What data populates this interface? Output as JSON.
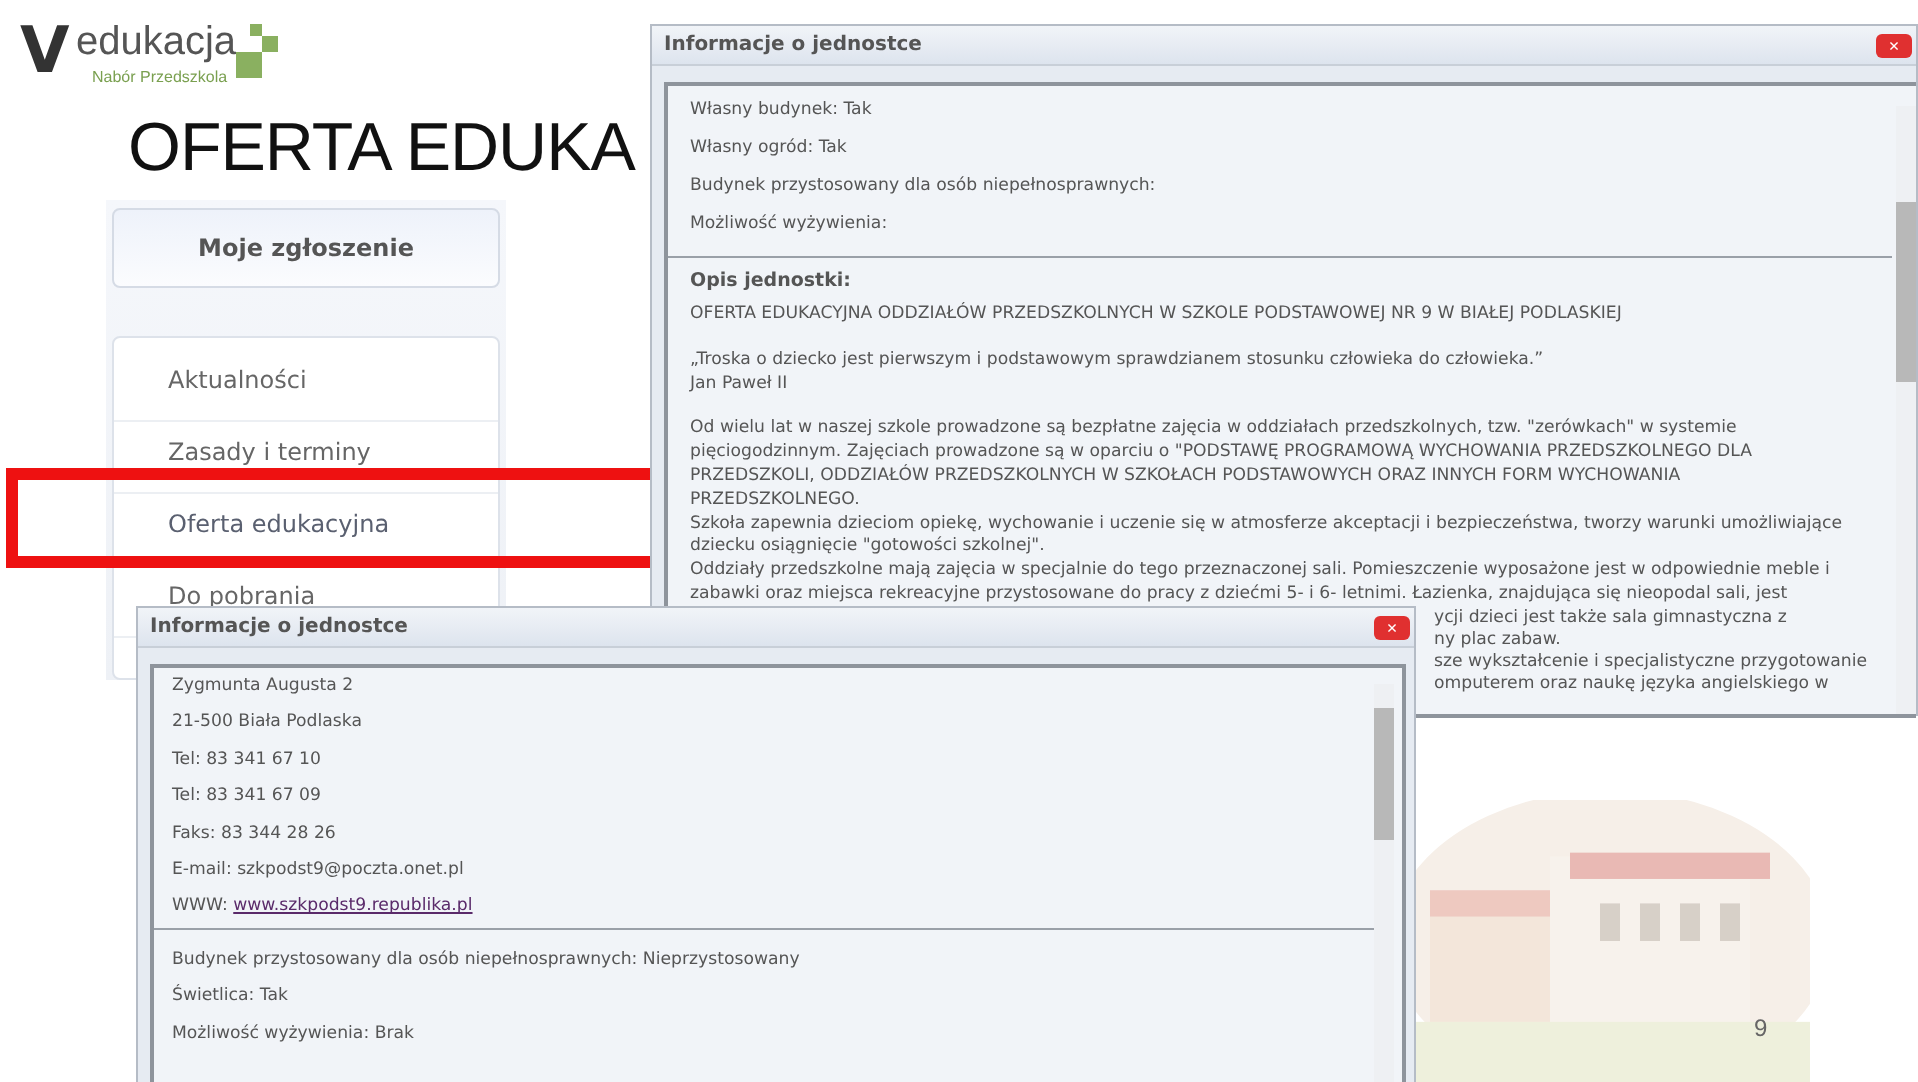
{
  "logo": {
    "mark": "V",
    "name": "edukacja",
    "tagline": "Nabór Przedszkola"
  },
  "slide_title": "OFERTA EDUKA",
  "sidebar": {
    "top_button": "Moje zgłoszenie",
    "items": [
      {
        "label": "Aktualności",
        "selected": false
      },
      {
        "label": "Zasady i terminy",
        "selected": false
      },
      {
        "label": "Oferta edukacyjna",
        "selected": true
      },
      {
        "label": "Do pobrania",
        "selected": false
      }
    ]
  },
  "back_window": {
    "title": "Informacje o jednostce",
    "close": "×",
    "facts": [
      "Własny budynek: Tak",
      "Własny ogród: Tak",
      "Budynek przystosowany dla osób niepełnosprawnych:",
      "Możliwość wyżywienia:"
    ],
    "description_heading": "Opis jednostki:",
    "paragraphs": [
      [
        "OFERTA EDUKACYJNA ODDZIAŁÓW PRZEDSZKOLNYCH W SZKOLE PODSTAWOWEJ NR 9 W BIAŁEJ PODLASKIEJ"
      ],
      [
        "„Troska o dziecko jest pierwszym i podstawowym sprawdzianem stosunku człowieka do człowieka.”",
        "Jan Paweł II"
      ],
      [
        "Od wielu lat w naszej szkole prowadzone są bezpłatne zajęcia w oddziałach przedszkolnych, tzw. \"zerówkach\" w systemie",
        "pięciogodzinnym. Zajęciach prowadzone są w oparciu o \"PODSTAWĘ PROGRAMOWĄ WYCHOWANIA PRZEDSZKOLNEGO DLA",
        "PRZEDSZKOLI, ODDZIAŁÓW PRZEDSZKOLNYCH W SZKOŁACH PODSTAWOWYCH ORAZ INNYCH FORM WYCHOWANIA",
        "PRZEDSZKOLNEGO.",
        "Szkoła zapewnia dzieciom opiekę, wychowanie i uczenie się w atmosferze akceptacji i bezpieczeństwa, tworzy warunki umożliwiające",
        "dziecku osiągnięcie \"gotowości szkolnej\".",
        "Oddziały przedszkolne mają zajęcia w specjalnie do tego przeznaczonej sali. Pomieszczenie wyposażone jest w odpowiednie meble i",
        "zabawki oraz miejsca rekreacyjne przystosowane do pracy z dziećmi 5- i 6- letnimi. Łazienka, znajdująca się nieopodal sali, jest"
      ]
    ],
    "covered_line_ends": [
      "ycji dzieci jest także sala gimnastyczna z",
      "ny plac zabaw.",
      "sze wykształcenie i specjalistyczne przygotowanie",
      "omputerem oraz naukę języka angielskiego w"
    ]
  },
  "front_window": {
    "title": "Informacje o jednostce",
    "close": "×",
    "contact": [
      {
        "text": "Zygmunta Augusta 2"
      },
      {
        "text": "21-500 Biała Podlaska"
      },
      {
        "text": "Tel: 83 341 67 10"
      },
      {
        "text": "Tel: 83 341 67 09"
      },
      {
        "text": "Faks: 83 344 28 26"
      },
      {
        "text": "E-mail: szkpodst9@poczta.onet.pl"
      },
      {
        "text": "WWW: ",
        "link": "www.szkpodst9.republika.pl"
      }
    ],
    "facts": [
      "Budynek przystosowany dla osób niepełnosprawnych: Nieprzystosowany",
      "Świetlica: Tak",
      "Możliwość wyżywienia: Brak"
    ]
  },
  "page_number": "9"
}
